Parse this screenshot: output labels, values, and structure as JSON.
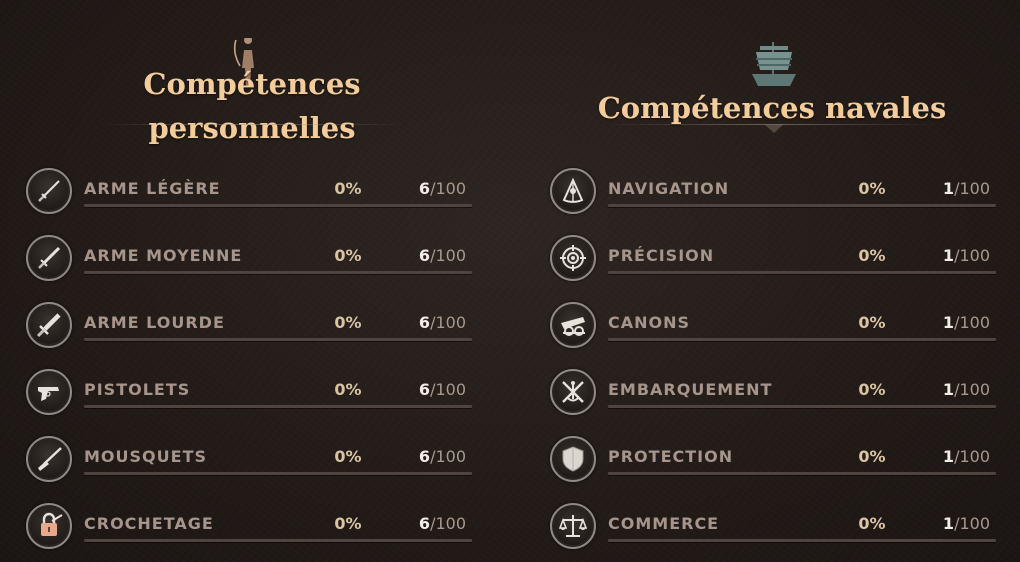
{
  "personal": {
    "title_line1": "Compétences",
    "title_line2": "personnelles",
    "skills": [
      {
        "name": "ARME LÉGÈRE",
        "percent": "0%",
        "level": "6",
        "sep": "/",
        "max": "100",
        "progress": 0,
        "icon": "light-sword-icon"
      },
      {
        "name": "ARME MOYENNE",
        "percent": "0%",
        "level": "6",
        "sep": "/",
        "max": "100",
        "progress": 0,
        "icon": "medium-sword-icon"
      },
      {
        "name": "ARME LOURDE",
        "percent": "0%",
        "level": "6",
        "sep": "/",
        "max": "100",
        "progress": 0,
        "icon": "heavy-sword-icon"
      },
      {
        "name": "PISTOLETS",
        "percent": "0%",
        "level": "6",
        "sep": "/",
        "max": "100",
        "progress": 0,
        "icon": "pistol-icon"
      },
      {
        "name": "MOUSQUETS",
        "percent": "0%",
        "level": "6",
        "sep": "/",
        "max": "100",
        "progress": 0,
        "icon": "musket-icon"
      },
      {
        "name": "CROCHETAGE",
        "percent": "0%",
        "level": "6",
        "sep": "/",
        "max": "100",
        "progress": 0,
        "icon": "lockpick-icon"
      }
    ]
  },
  "naval": {
    "title": "Compétences navales",
    "skills": [
      {
        "name": "NAVIGATION",
        "percent": "0%",
        "level": "1",
        "sep": "/",
        "max": "100",
        "progress": 0,
        "icon": "sextant-icon"
      },
      {
        "name": "PRÉCISION",
        "percent": "0%",
        "level": "1",
        "sep": "/",
        "max": "100",
        "progress": 0,
        "icon": "crosshair-icon"
      },
      {
        "name": "CANONS",
        "percent": "0%",
        "level": "1",
        "sep": "/",
        "max": "100",
        "progress": 0,
        "icon": "cannon-icon"
      },
      {
        "name": "EMBARQUEMENT",
        "percent": "0%",
        "level": "1",
        "sep": "/",
        "max": "100",
        "progress": 0,
        "icon": "boarding-icon"
      },
      {
        "name": "PROTECTION",
        "percent": "0%",
        "level": "1",
        "sep": "/",
        "max": "100",
        "progress": 0,
        "icon": "shield-icon"
      },
      {
        "name": "COMMERCE",
        "percent": "0%",
        "level": "1",
        "sep": "/",
        "max": "100",
        "progress": 0,
        "icon": "scales-icon"
      }
    ]
  },
  "colors": {
    "title": "#f3cc9c",
    "skill_name": "#a7948a",
    "percent": "#d9c3a3",
    "level": "#f2ece6",
    "icon_glyph": "#e8e2dc",
    "lockpick_accent": "#e7a98a"
  }
}
